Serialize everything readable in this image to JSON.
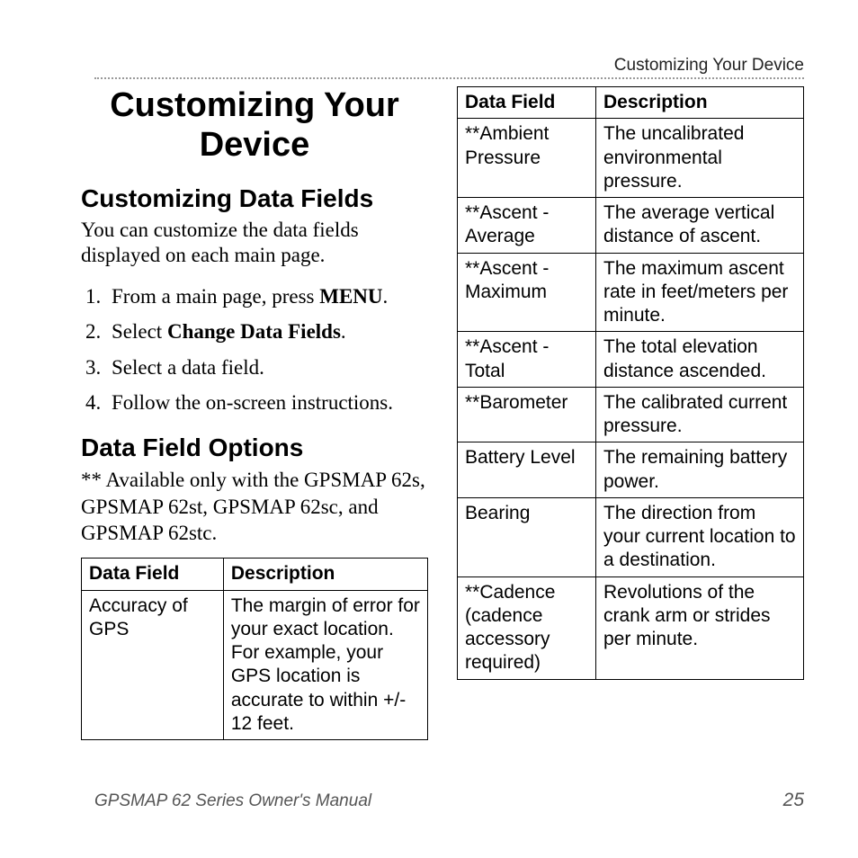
{
  "running_head": "Customizing Your Device",
  "title": "Customizing Your Device",
  "section1": {
    "heading": "Customizing Data Fields",
    "intro": "You can customize the data fields displayed on each main page.",
    "steps": [
      {
        "pre": "From a main page, press ",
        "strong": "MENU",
        "post": "."
      },
      {
        "pre": "Select ",
        "strong": "Change Data Fields",
        "post": "."
      },
      {
        "pre": "Select a data field.",
        "strong": "",
        "post": ""
      },
      {
        "pre": "Follow the on-screen instructions.",
        "strong": "",
        "post": ""
      }
    ]
  },
  "section2": {
    "heading": "Data Field Options",
    "note": "** Available only with the GPSMAP 62s, GPSMAP 62st, GPSMAP 62sc, and GPSMAP 62stc."
  },
  "table_headers": {
    "field": "Data Field",
    "desc": "Description"
  },
  "left_table": [
    {
      "field": "Accuracy of GPS",
      "desc": "The margin of error for your exact location. For example, your GPS location is accurate to within +/- 12 feet."
    }
  ],
  "right_table": [
    {
      "field": "**Ambient Pressure",
      "desc": "The uncalibrated environmental pressure."
    },
    {
      "field": "**Ascent - Average",
      "desc": "The average vertical distance of ascent."
    },
    {
      "field": "**Ascent - Maximum",
      "desc": "The maximum ascent rate in feet/meters per minute."
    },
    {
      "field": "**Ascent - Total",
      "desc": "The total elevation distance ascended."
    },
    {
      "field": "**Barometer",
      "desc": "The calibrated current pressure."
    },
    {
      "field": "Battery Level",
      "desc": "The remaining battery power."
    },
    {
      "field": "Bearing",
      "desc": "The direction from your current location to a destination."
    },
    {
      "field": "**Cadence (cadence accessory required)",
      "desc": "Revolutions of the crank arm or strides per minute."
    }
  ],
  "footer": {
    "left": "GPSMAP 62 Series Owner's Manual",
    "right": "25"
  }
}
